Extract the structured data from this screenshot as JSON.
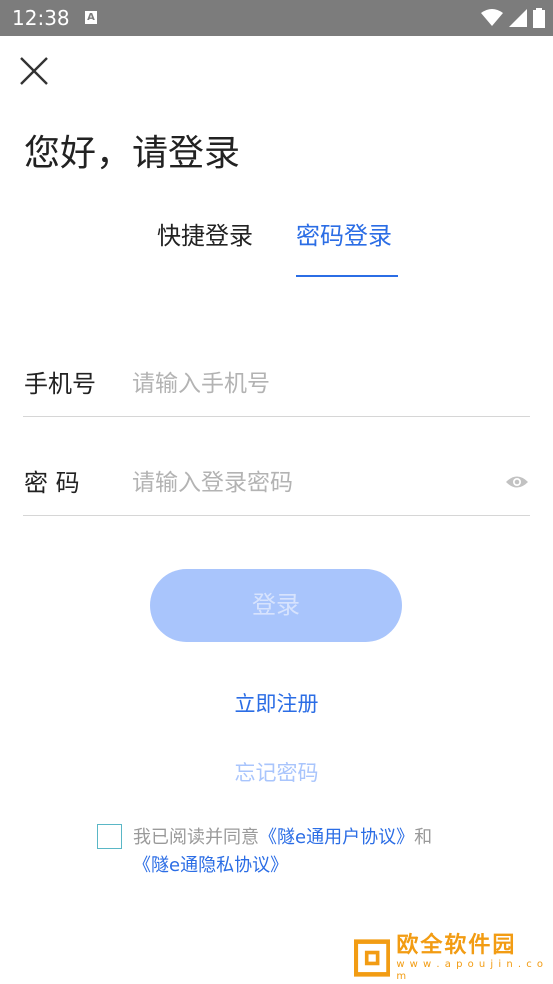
{
  "status_bar": {
    "time": "12:38",
    "notification_letter": "A"
  },
  "header": {
    "title": "您好，请登录"
  },
  "tabs": [
    {
      "label": "快捷登录",
      "active": false
    },
    {
      "label": "密码登录",
      "active": true
    }
  ],
  "form": {
    "phone_label": "手机号",
    "phone_placeholder": "请输入手机号",
    "phone_value": "",
    "password_label": "密 码",
    "password_placeholder": "请输入登录密码",
    "password_value": ""
  },
  "buttons": {
    "login_label": "登录",
    "register_label": "立即注册",
    "forgot_label": "忘记密码"
  },
  "agreement": {
    "prefix": "我已阅读并同意",
    "user_agreement": "《隧e通用户协议》",
    "conjunction": "和",
    "privacy_agreement": "《隧e通隐私协议》",
    "checked": false
  },
  "watermark": {
    "title": "欧全软件园",
    "url": "w w w . a p o u j i n . c o m"
  },
  "colors": {
    "accent": "#2b6de5",
    "button_disabled": "#a9c5fc",
    "status_bar": "#7c7c7c"
  }
}
